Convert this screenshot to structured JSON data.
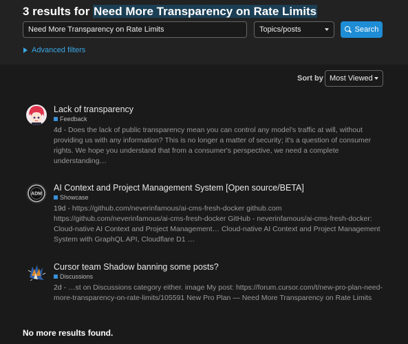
{
  "header": {
    "prefix": "3 results for",
    "term": "Need More Transparency on Rate Limits"
  },
  "search": {
    "value": "Need More Transparency on Rate Limits",
    "type_select": "Topics/posts",
    "button_label": "Search"
  },
  "advanced_filters_label": "Advanced filters",
  "sort": {
    "label": "Sort by",
    "value": "Most Viewed"
  },
  "results": [
    {
      "title": "Lack of transparency",
      "category": "Feedback",
      "date": "4d",
      "blurb": " - Does the lack of public transparency mean you can control any model's traffic at will, without providing us with any information? This is no longer a matter of security; it's a question of consumer rights. We hope you understand that from a consumer's perspective, we need a complete understanding…"
    },
    {
      "title": "AI Context and Project Management System [Open source/BETA]",
      "category": "Showcase",
      "date": "19d",
      "blurb": " - https://github.com/neverinfamous/ai-cms-fresh-docker github.com https://github.com/neverinfamous/ai-cms-fresh-docker GitHub - neverinfamous/ai-cms-fresh-docker: Cloud-native AI Context and Project Management… Cloud-native AI Context and Project Management System with GraphQL API, Cloudflare D1 …"
    },
    {
      "title": "Cursor team Shadow banning some posts?",
      "category": "Discussions",
      "date": "2d",
      "blurb": " - …st on Discussions category either. image My post: https://forum.cursor.com/t/new-pro-plan-need-more-transparency-on-rate-limits/105591 New Pro Plan — Need More Transparency on Rate Limits"
    }
  ],
  "no_more_label": "No more results found.",
  "colors": {
    "accent": "#1f8dd6",
    "link": "#3ba8e6",
    "category_square": "#3a8fd9"
  },
  "icons": {
    "search": "magnifier-icon",
    "expand": "triangle-right-icon",
    "dropdown": "chevron-down-icon"
  }
}
